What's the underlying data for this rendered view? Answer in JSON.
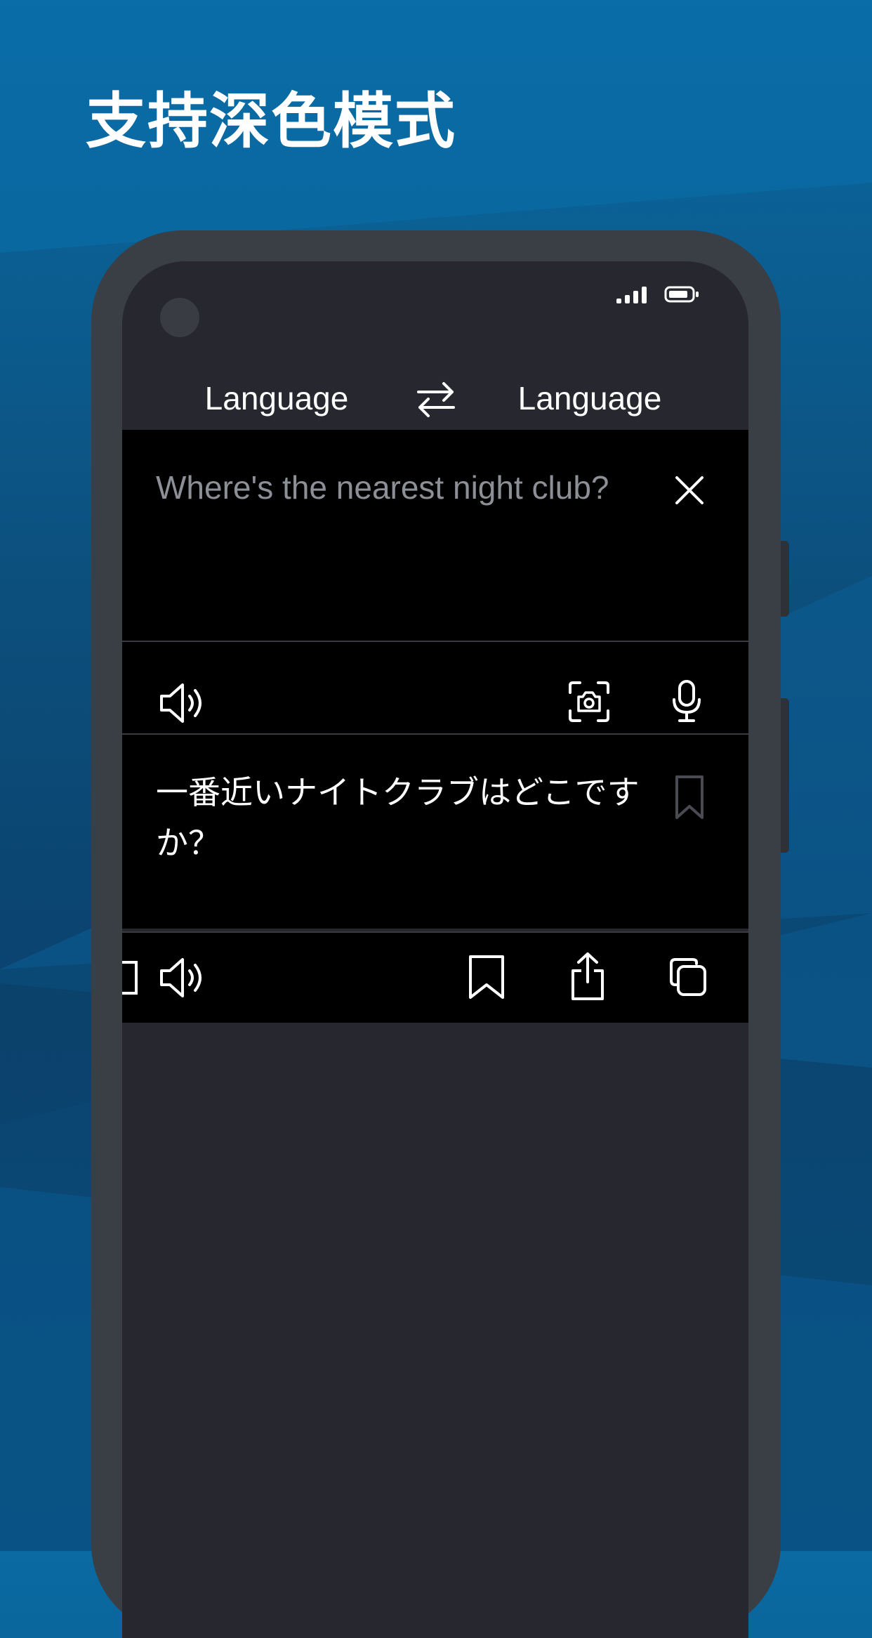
{
  "headline": "支持深色模式",
  "status_bar": {
    "signal_icon": "cellular-signal-icon",
    "battery_icon": "battery-icon"
  },
  "languages": {
    "source_label": "Language",
    "target_label": "Language",
    "swap_icon": "swap-arrows-icon"
  },
  "source": {
    "text": "Where's the nearest night club?",
    "clear_icon": "close-icon",
    "toolbar": [
      "speaker-icon",
      "camera-scan-icon",
      "microphone-icon"
    ]
  },
  "translation": {
    "text": "一番近いナイトクラブはどこですか？",
    "bookmark_icon": "bookmark-icon",
    "toolbar": [
      "speaker-icon",
      "bookmark-icon",
      "share-icon",
      "copy-icon"
    ]
  },
  "colors": {
    "background": "#0c4f7d",
    "phone_frame": "#3a3e45",
    "screen": "#26272f",
    "panel": "#000000",
    "primary_text": "#ffffff",
    "placeholder_text": "#8d8f96"
  }
}
